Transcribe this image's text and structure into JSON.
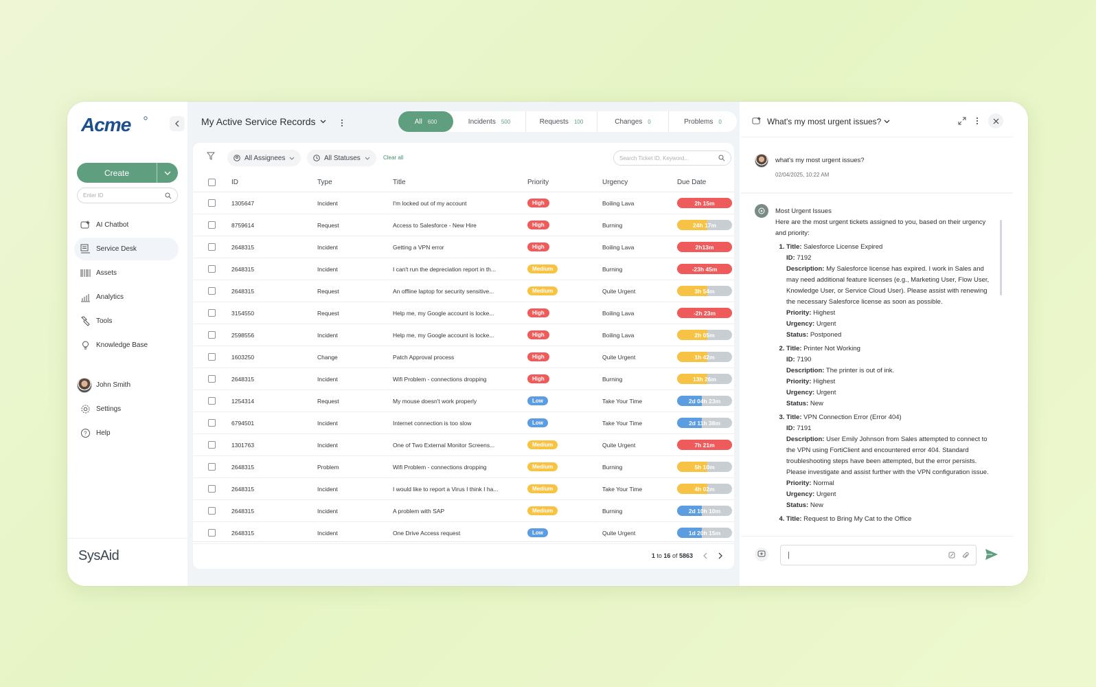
{
  "sidebar": {
    "create_label": "Create",
    "enter_id_placeholder": "Enter ID",
    "items": [
      {
        "label": "AI Chatbot"
      },
      {
        "label": "Service Desk"
      },
      {
        "label": "Assets"
      },
      {
        "label": "Analytics"
      },
      {
        "label": "Tools"
      },
      {
        "label": "Knowledge Base"
      }
    ],
    "user_name": "John Smith",
    "settings_label": "Settings",
    "help_label": "Help",
    "brand": "SysAid"
  },
  "header": {
    "title": "My Active Service Records",
    "tabs": [
      {
        "label": "All",
        "count": "600"
      },
      {
        "label": "Incidents",
        "count": "500"
      },
      {
        "label": "Requests",
        "count": "100"
      },
      {
        "label": "Changes",
        "count": "0"
      },
      {
        "label": "Problems",
        "count": "0"
      }
    ]
  },
  "filters": {
    "assignees": "All Assignees",
    "statuses": "All Statuses",
    "clear_all": "Clear all",
    "search_placeholder": "Search Ticket ID, Keyword..."
  },
  "table": {
    "columns": [
      "ID",
      "Type",
      "Title",
      "Priority",
      "Urgency",
      "Due Date"
    ],
    "rows": [
      {
        "id": "1305647",
        "type": "Incident",
        "title": "I'm locked out of my account",
        "priority": "High",
        "urgency": "Boiling Lava",
        "due": "2h 15m",
        "due_color": "#ef5a5a",
        "due_fill": 1.0
      },
      {
        "id": "8759614",
        "type": "Request",
        "title": "Access to Salesforce - New Hire",
        "priority": "High",
        "urgency": "Burning",
        "due": "24h 17m",
        "due_color": "#f6c344",
        "due_fill": 0.55
      },
      {
        "id": "2648315",
        "type": "Incident",
        "title": "Getting a VPN error",
        "priority": "High",
        "urgency": "Boiling Lava",
        "due": "2h13m",
        "due_color": "#ef5a5a",
        "due_fill": 1.0
      },
      {
        "id": "2648315",
        "type": "Incident",
        "title": "I can't run the depreciation report in th...",
        "priority": "Medium",
        "urgency": "Burning",
        "due": "-23h 45m",
        "due_color": "#ef5a5a",
        "due_fill": 1.0
      },
      {
        "id": "2648315",
        "type": "Request",
        "title": "An offline laptop for security sensitive...",
        "priority": "Medium",
        "urgency": "Quite Urgent",
        "due": "3h 54m",
        "due_color": "#f6c344",
        "due_fill": 0.55
      },
      {
        "id": "3154550",
        "type": "Request",
        "title": "Help me, my Google account is locke...",
        "priority": "High",
        "urgency": "Boiling Lava",
        "due": "-2h 23m",
        "due_color": "#ef5a5a",
        "due_fill": 1.0
      },
      {
        "id": "2598556",
        "type": "Incident",
        "title": "Help me, my Google account is locke...",
        "priority": "High",
        "urgency": "Boiling Lava",
        "due": "2h 05m",
        "due_color": "#f6c344",
        "due_fill": 0.55
      },
      {
        "id": "1603250",
        "type": "Change",
        "title": "Patch Approval process",
        "priority": "High",
        "urgency": "Quite Urgent",
        "due": "1h 42m",
        "due_color": "#f6c344",
        "due_fill": 0.55
      },
      {
        "id": "2648315",
        "type": "Incident",
        "title": "Wifi Problem - connections dropping",
        "priority": "High",
        "urgency": "Burning",
        "due": "13h 26m",
        "due_color": "#f6c344",
        "due_fill": 0.55
      },
      {
        "id": "1254314",
        "type": "Request",
        "title": "My mouse doesn't work properly",
        "priority": "Low",
        "urgency": "Take Your Time",
        "due": "2d 04h 23m",
        "due_color": "#5b9de0",
        "due_fill": 0.45
      },
      {
        "id": "6794501",
        "type": "Incident",
        "title": "Internet connection is too slow",
        "priority": "Low",
        "urgency": "Take Your Time",
        "due": "2d 11h 38m",
        "due_color": "#5b9de0",
        "due_fill": 0.45
      },
      {
        "id": "1301763",
        "type": "Incident",
        "title": "One of Two External Monitor Screens...",
        "priority": "Medium",
        "urgency": "Quite Urgent",
        "due": "7h 21m",
        "due_color": "#ef5a5a",
        "due_fill": 1.0
      },
      {
        "id": "2648315",
        "type": "Problem",
        "title": "Wifi Problem - connections dropping",
        "priority": "Medium",
        "urgency": "Burning",
        "due": "5h 10m",
        "due_color": "#f6c344",
        "due_fill": 0.55
      },
      {
        "id": "2648315",
        "type": "Incident",
        "title": "I would like to report a Virus I think I ha...",
        "priority": "Medium",
        "urgency": "Take Your Time",
        "due": "4h 02m",
        "due_color": "#f6c344",
        "due_fill": 0.55
      },
      {
        "id": "2648315",
        "type": "Incident",
        "title": "A problem with SAP",
        "priority": "Medium",
        "urgency": "Burning",
        "due": "2d 10h 10m",
        "due_color": "#5b9de0",
        "due_fill": 0.45
      },
      {
        "id": "2648315",
        "type": "Incident",
        "title": " One Drive Access request",
        "priority": "Low",
        "urgency": "Quite Urgent",
        "due": "1d 20h 15m",
        "due_color": "#5b9de0",
        "due_fill": 0.45
      }
    ],
    "pager": {
      "from": "1",
      "to_word": "to",
      "to": "16",
      "of_word": "of",
      "total": "5863"
    }
  },
  "chat": {
    "title": "What's my most urgent issues?",
    "user_message": "what's my most urgent issues?",
    "timestamp": "02/04/2025, 10:22 AM",
    "bot_heading": "Most Urgent Issues",
    "bot_intro": "Here are the most urgent tickets assigned to you, based on their urgency and priority:",
    "labels": {
      "title": "Title:",
      "id": "ID:",
      "description": "Description:",
      "priority": "Priority:",
      "urgency": "Urgency:",
      "status": "Status:"
    },
    "tickets": [
      {
        "title": "Salesforce License Expired",
        "id": "7192",
        "description": "My Salesforce license has expired. I work in Sales and may need additional feature licenses (e.g., Marketing User, Flow User, Knowledge User, or Service Cloud User). Please assist with renewing the necessary Salesforce license as soon as possible.",
        "priority": "Highest",
        "urgency": "Urgent",
        "status": "Postponed"
      },
      {
        "title": "Printer Not Working",
        "id": "7190",
        "description": "The printer is out of ink.",
        "priority": "Highest",
        "urgency": "Urgent",
        "status": "New"
      },
      {
        "title": "VPN Connection Error (Error 404)",
        "id": "7191",
        "description": "User Emily Johnson from Sales attempted to connect to the VPN using FortiClient and encountered error 404. Standard troubleshooting steps have been attempted, but the error persists. Please investigate and assist further with the VPN configuration issue.",
        "priority": "Normal",
        "urgency": "Urgent",
        "status": "New"
      },
      {
        "title": "Request to Bring My Cat to the Office"
      }
    ],
    "input_value": "|"
  },
  "colors": {
    "accent": "#5f9e7e",
    "high": "#ef5a5a",
    "medium": "#f6c344",
    "low": "#5b9de0"
  }
}
